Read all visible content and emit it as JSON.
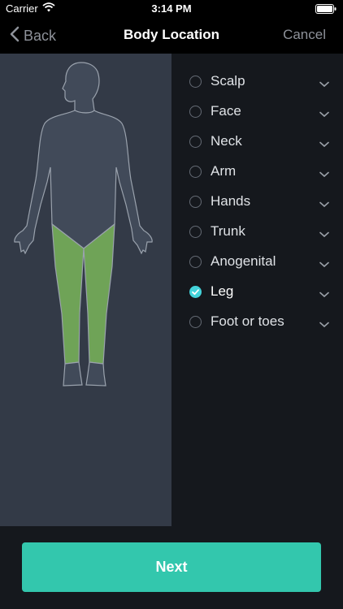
{
  "status_bar": {
    "carrier": "Carrier",
    "time": "3:14 PM",
    "wifi_icon": "wifi-icon",
    "battery_icon": "battery-icon"
  },
  "nav": {
    "back_label": "Back",
    "title": "Body Location",
    "cancel_label": "Cancel"
  },
  "body_map": {
    "highlighted_region": "Leg",
    "highlight_color": "#6fa357",
    "figure_color": "#414a59",
    "outline_color": "#9aa2ad"
  },
  "locations": [
    {
      "label": "Scalp",
      "checked": false
    },
    {
      "label": "Face",
      "checked": false
    },
    {
      "label": "Neck",
      "checked": false
    },
    {
      "label": "Arm",
      "checked": false
    },
    {
      "label": "Hands",
      "checked": false
    },
    {
      "label": "Trunk",
      "checked": false
    },
    {
      "label": "Anogenital",
      "checked": false
    },
    {
      "label": "Leg",
      "checked": true
    },
    {
      "label": "Foot or toes",
      "checked": false
    }
  ],
  "next_label": "Next",
  "colors": {
    "accent": "#43d3da",
    "button": "#33c7ad",
    "background": "#15181d",
    "panel": "#333a47"
  }
}
